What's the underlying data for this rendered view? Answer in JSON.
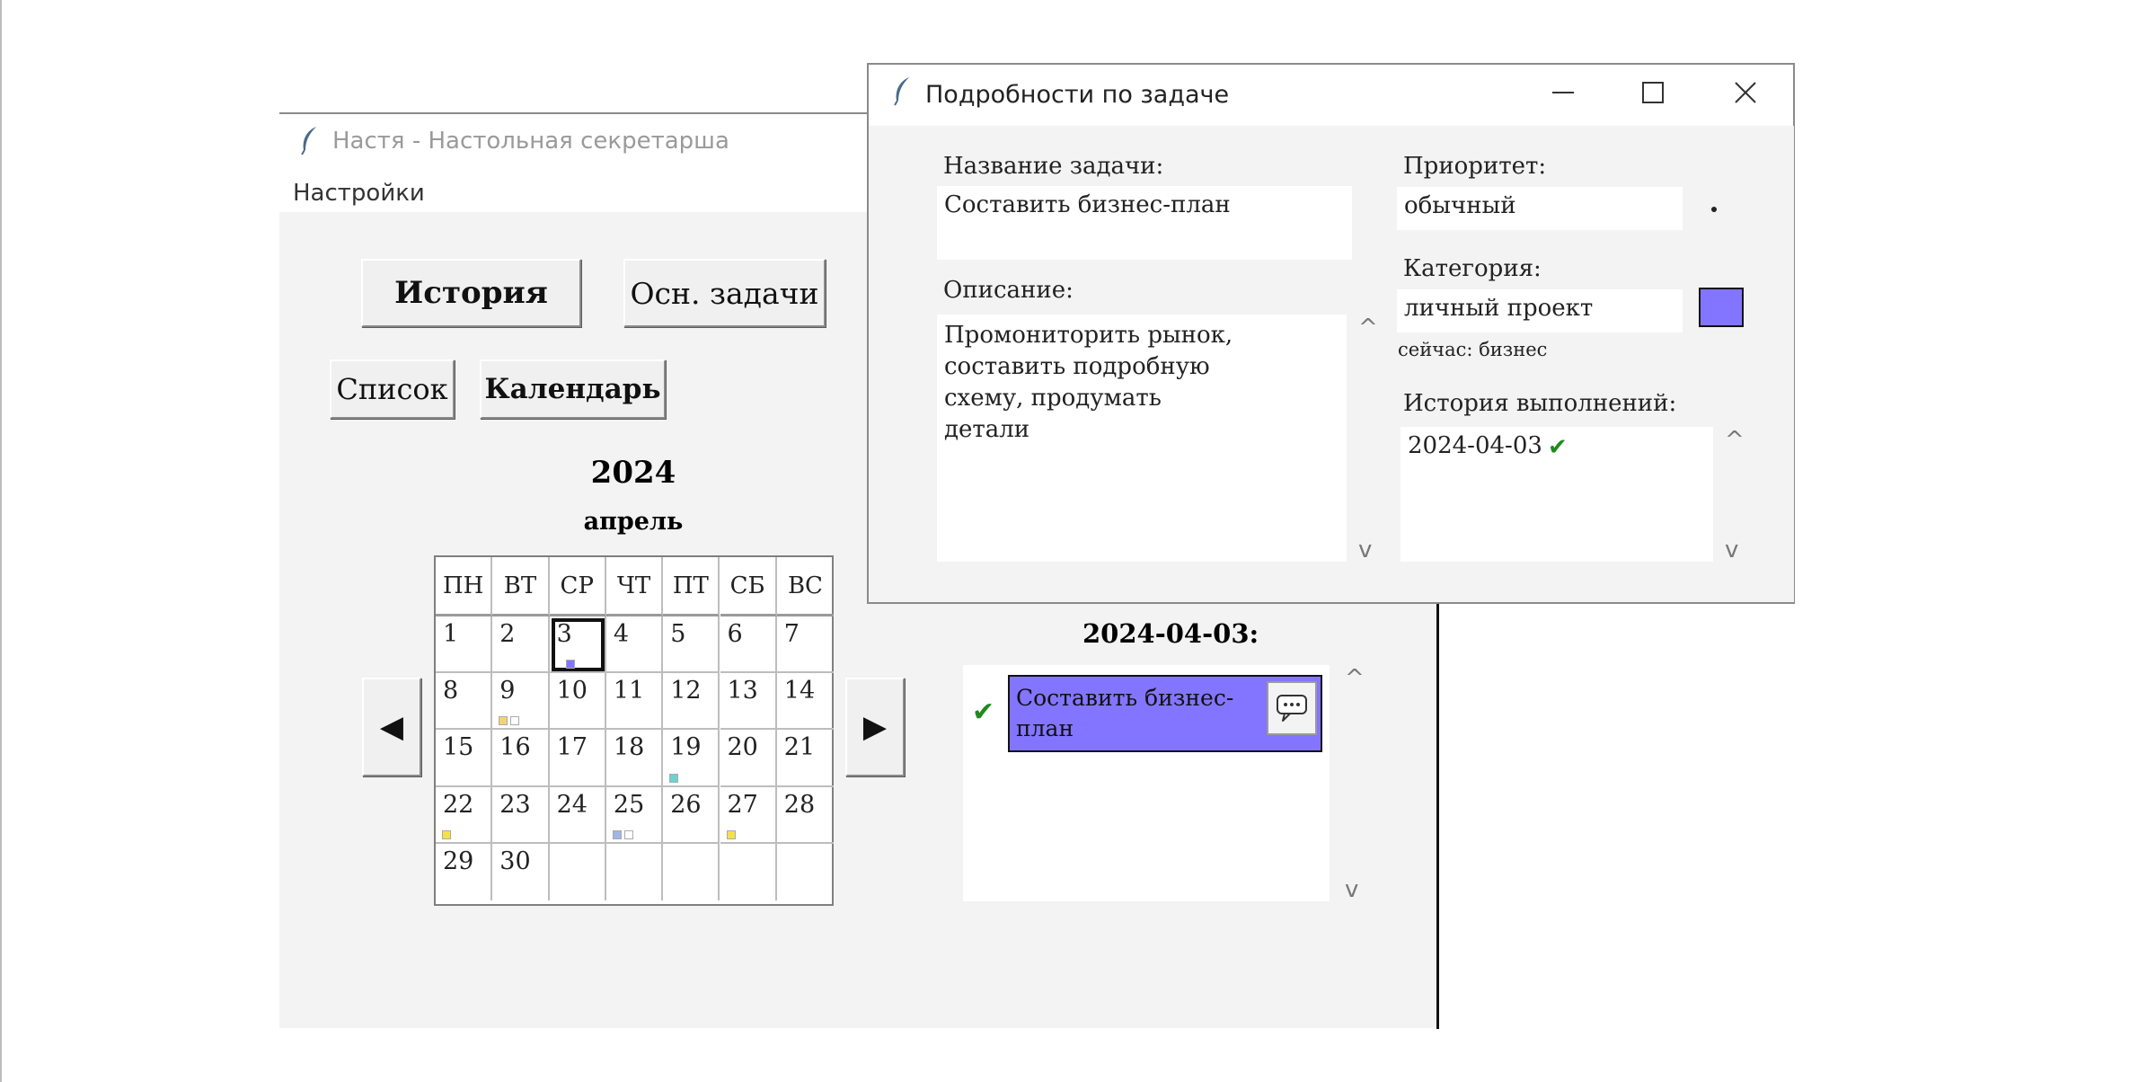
{
  "main_window": {
    "title": "Настя - Настольная секретарша",
    "menu": {
      "settings": "Настройки"
    },
    "buttons": {
      "history": "История",
      "main_tasks": "Осн. задачи",
      "list": "Список",
      "calendar": "Календарь",
      "prev": "◀",
      "next": "▶"
    },
    "calendar": {
      "year": "2024",
      "month": "апрель",
      "weekdays": [
        "ПН",
        "ВТ",
        "СР",
        "ЧТ",
        "ПТ",
        "СБ",
        "ВС"
      ],
      "weeks": [
        [
          "1",
          "2",
          "3",
          "4",
          "5",
          "6",
          "7"
        ],
        [
          "8",
          "9",
          "10",
          "11",
          "12",
          "13",
          "14"
        ],
        [
          "15",
          "16",
          "17",
          "18",
          "19",
          "20",
          "21"
        ],
        [
          "22",
          "23",
          "24",
          "25",
          "26",
          "27",
          "28"
        ],
        [
          "29",
          "30",
          "",
          "",
          "",
          "",
          ""
        ]
      ],
      "selected_day": "3",
      "day_marks": {
        "3": [
          "#8375ff"
        ],
        "9": [
          "#f2d27a",
          "#ffffff"
        ],
        "19": [
          "#6fd0d0"
        ],
        "22": [
          "#f5e04a"
        ],
        "25": [
          "#9fb6e6",
          "#ffffff"
        ],
        "27": [
          "#f5e04a"
        ]
      }
    },
    "day_panel": {
      "date_label": "2024-04-03:",
      "task_title": "Составить бизнес-план",
      "task_color": "#8375ff",
      "task_done_icon": "check-icon",
      "comment_icon": "speech-bubble-icon",
      "scroll_up": "^",
      "scroll_down": "v"
    }
  },
  "detail_window": {
    "title": "Подробности по задаче",
    "window_controls": {
      "minimize": "minimize-icon",
      "maximize": "maximize-icon",
      "close": "close-icon"
    },
    "task_name_label": "Название задачи:",
    "task_name_value": "Составить бизнес-план",
    "description_label": "Описание:",
    "description_value": "Промониторить рынок, составить подробную схему, продумать детали",
    "priority_label": "Приоритет:",
    "priority_value": "обычный",
    "category_label": "Категория:",
    "category_value": "личный проект",
    "category_current": "сейчас: бизнес",
    "category_color": "#8375ff",
    "history_label": "История выполнений:",
    "history_entries": [
      "2024-04-03"
    ],
    "scroll_up": "^",
    "scroll_down": "v"
  }
}
